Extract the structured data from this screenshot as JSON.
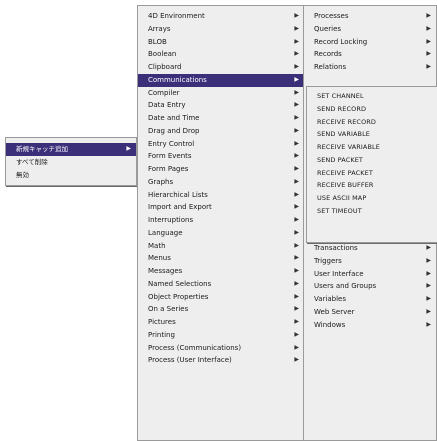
{
  "context_menu": {
    "items": [
      {
        "label": "新規キャッチ追加",
        "submenu": true,
        "selected": true
      },
      {
        "label": "すべて削除",
        "submenu": false,
        "selected": false
      },
      {
        "label": "無効",
        "submenu": false,
        "selected": false
      }
    ]
  },
  "themes_menu": {
    "items": [
      {
        "label": "4D Environment",
        "submenu": true
      },
      {
        "label": "Arrays",
        "submenu": true
      },
      {
        "label": "BLOB",
        "submenu": true
      },
      {
        "label": "Boolean",
        "submenu": true
      },
      {
        "label": "Clipboard",
        "submenu": true
      },
      {
        "label": "Communications",
        "submenu": true,
        "selected": true
      },
      {
        "label": "Compiler",
        "submenu": true
      },
      {
        "label": "Data Entry",
        "submenu": true
      },
      {
        "label": "Date and Time",
        "submenu": true
      },
      {
        "label": "Drag and Drop",
        "submenu": true
      },
      {
        "label": "Entry Control",
        "submenu": true
      },
      {
        "label": "Form Events",
        "submenu": true
      },
      {
        "label": "Form Pages",
        "submenu": true
      },
      {
        "label": "Graphs",
        "submenu": true
      },
      {
        "label": "Hierarchical Lists",
        "submenu": true
      },
      {
        "label": "Import and Export",
        "submenu": true
      },
      {
        "label": "Interruptions",
        "submenu": true
      },
      {
        "label": "Language",
        "submenu": true
      },
      {
        "label": "Math",
        "submenu": true
      },
      {
        "label": "Menus",
        "submenu": true
      },
      {
        "label": "Messages",
        "submenu": true
      },
      {
        "label": "Named Selections",
        "submenu": true
      },
      {
        "label": "Object Properties",
        "submenu": true
      },
      {
        "label": "On a Series",
        "submenu": true
      },
      {
        "label": "Pictures",
        "submenu": true
      },
      {
        "label": "Printing",
        "submenu": true
      },
      {
        "label": "Process (Communications)",
        "submenu": true
      },
      {
        "label": "Process (User Interface)",
        "submenu": true
      }
    ]
  },
  "themes_menu_2": {
    "top_items": [
      {
        "label": "Processes",
        "submenu": true
      },
      {
        "label": "Queries",
        "submenu": true
      },
      {
        "label": "Record Locking",
        "submenu": true
      },
      {
        "label": "Records",
        "submenu": true
      },
      {
        "label": "Relations",
        "submenu": true
      }
    ],
    "bottom_items": [
      {
        "label": "Transactions",
        "submenu": true
      },
      {
        "label": "Triggers",
        "submenu": true
      },
      {
        "label": "User Interface",
        "submenu": true
      },
      {
        "label": "Users and Groups",
        "submenu": true
      },
      {
        "label": "Variables",
        "submenu": true
      },
      {
        "label": "Web Server",
        "submenu": true
      },
      {
        "label": "Windows",
        "submenu": true
      }
    ]
  },
  "commands_menu": {
    "items": [
      {
        "label": "SET CHANNEL"
      },
      {
        "label": "SEND RECORD"
      },
      {
        "label": "RECEIVE RECORD"
      },
      {
        "label": "SEND VARIABLE"
      },
      {
        "label": "RECEIVE VARIABLE"
      },
      {
        "label": "SEND PACKET"
      },
      {
        "label": "RECEIVE PACKET"
      },
      {
        "label": "RECEIVE BUFFER"
      },
      {
        "label": "USE ASCII MAP"
      },
      {
        "label": "SET TIMEOUT"
      }
    ]
  },
  "arrow_glyph": "▶",
  "colors": {
    "menu_background": "#eeeeee",
    "highlight": "#3b2f7a",
    "highlight_text": "#ffffff"
  }
}
